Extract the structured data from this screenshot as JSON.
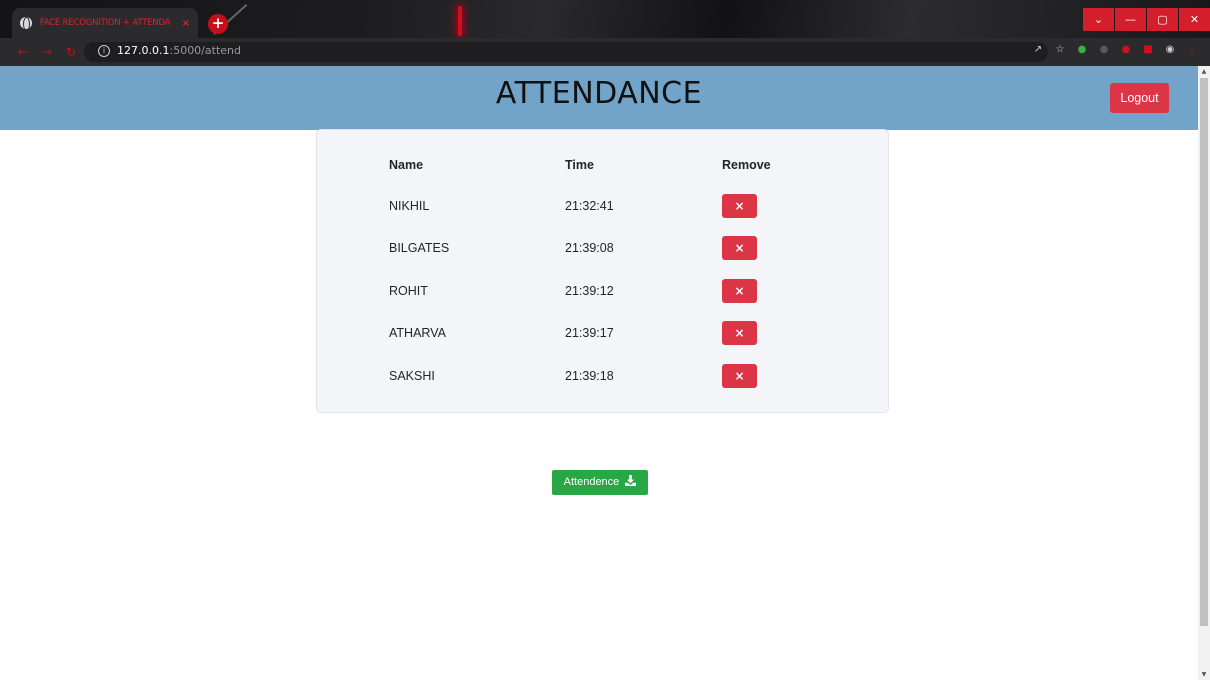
{
  "browser": {
    "tab_title": "FACE RECOGNITION + ATTENDA",
    "tab_close": "×",
    "new_tab": "+",
    "url_host": "127.0.0.1",
    "url_path": ":5000/attend",
    "window_controls": [
      "⌄",
      "—",
      "▢",
      "✕"
    ]
  },
  "header": {
    "title": "ATTENDANCE",
    "logout_label": "Logout"
  },
  "table": {
    "columns": [
      "Name",
      "Time",
      "Remove"
    ],
    "rows": [
      {
        "name": "NIKHIL",
        "time": "21:32:41",
        "remove": "×"
      },
      {
        "name": "BILGATES",
        "time": "21:39:08",
        "remove": "×"
      },
      {
        "name": "ROHIT",
        "time": "21:39:12",
        "remove": "×"
      },
      {
        "name": "ATHARVA",
        "time": "21:39:17",
        "remove": "×"
      },
      {
        "name": "SAKSHI",
        "time": "21:39:18",
        "remove": "×"
      }
    ]
  },
  "download": {
    "label": "Attendence"
  },
  "colors": {
    "header_bg": "#72a4c9",
    "danger": "#dc3545",
    "success": "#28a745",
    "card_bg": "#f4f5f9"
  },
  "icons": {
    "download": "download-icon",
    "remove": "close-icon",
    "info": "info-icon"
  }
}
